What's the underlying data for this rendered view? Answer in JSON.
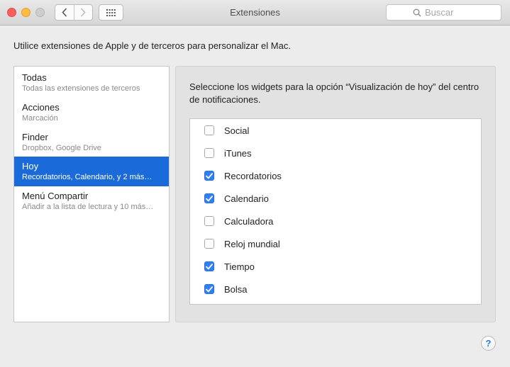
{
  "window": {
    "title": "Extensiones",
    "search_placeholder": "Buscar"
  },
  "intro": "Utilice extensiones de Apple y de terceros para personalizar el Mac.",
  "sidebar": {
    "items": [
      {
        "title": "Todas",
        "subtitle": "Todas las extensiones de terceros",
        "selected": false
      },
      {
        "title": "Acciones",
        "subtitle": "Marcación",
        "selected": false
      },
      {
        "title": "Finder",
        "subtitle": "Dropbox, Google Drive",
        "selected": false
      },
      {
        "title": "Hoy",
        "subtitle": "Recordatorios, Calendario, y 2 más…",
        "selected": true
      },
      {
        "title": "Menú Compartir",
        "subtitle": "Añadir a la lista de lectura y 10 más…",
        "selected": false
      }
    ]
  },
  "panel": {
    "description": "Seleccione los widgets para la opción “Visualización de hoy” del centro de notificaciones.",
    "widgets": [
      {
        "label": "Social",
        "checked": false
      },
      {
        "label": "iTunes",
        "checked": false
      },
      {
        "label": "Recordatorios",
        "checked": true
      },
      {
        "label": "Calendario",
        "checked": true
      },
      {
        "label": "Calculadora",
        "checked": false
      },
      {
        "label": "Reloj mundial",
        "checked": false
      },
      {
        "label": "Tiempo",
        "checked": true
      },
      {
        "label": "Bolsa",
        "checked": true
      }
    ]
  },
  "help_label": "?",
  "colors": {
    "selection": "#1a6ad9",
    "checkbox_checked": "#2f80f5",
    "close": "#fc605c",
    "minimize": "#fdbc40"
  }
}
